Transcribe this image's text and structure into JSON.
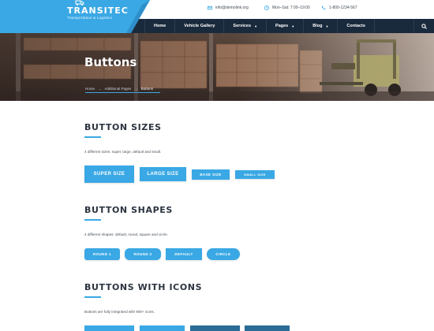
{
  "brand": {
    "name": "TRANSITEC",
    "tagline": "Transportation & Logistics"
  },
  "contacts": [
    {
      "icon": "envelope-icon",
      "text": "info@demolink.org"
    },
    {
      "icon": "clock-icon",
      "text": "Mon–Sat: 7:00–19:00"
    },
    {
      "icon": "phone-icon",
      "text": "1-800-1234-567"
    }
  ],
  "nav": [
    {
      "label": "Home",
      "dropdown": false
    },
    {
      "label": "Vehicle Gallery",
      "dropdown": false
    },
    {
      "label": "Services",
      "dropdown": true
    },
    {
      "label": "Pages",
      "dropdown": true
    },
    {
      "label": "Blog",
      "dropdown": true
    },
    {
      "label": "Contacts",
      "dropdown": false
    }
  ],
  "hero": {
    "title": "Buttons",
    "breadcrumbs": [
      "Home",
      "Additional Pages",
      "Buttons"
    ]
  },
  "sections": {
    "sizes": {
      "title": "BUTTON SIZES",
      "desc": "4 different sizes: super, large, default and small.",
      "buttons": [
        "SUPER SIZE",
        "LARGE SIZE",
        "BASE SIZE",
        "SMALL SIZE"
      ]
    },
    "shapes": {
      "title": "BUTTON SHAPES",
      "desc": "4 different shapes: default, round, square and circle.",
      "buttons": [
        "ROUND 1",
        "ROUND 2",
        "DEFAULT",
        "CIRCLE"
      ]
    },
    "icons": {
      "title": "BUTTONS WITH ICONS",
      "desc": "Buttons are fully integrated with 900+ icons."
    }
  },
  "colors": {
    "accent": "#3aa8e4",
    "nav_bg": "#1a2a3d",
    "text": "#2b3440"
  }
}
